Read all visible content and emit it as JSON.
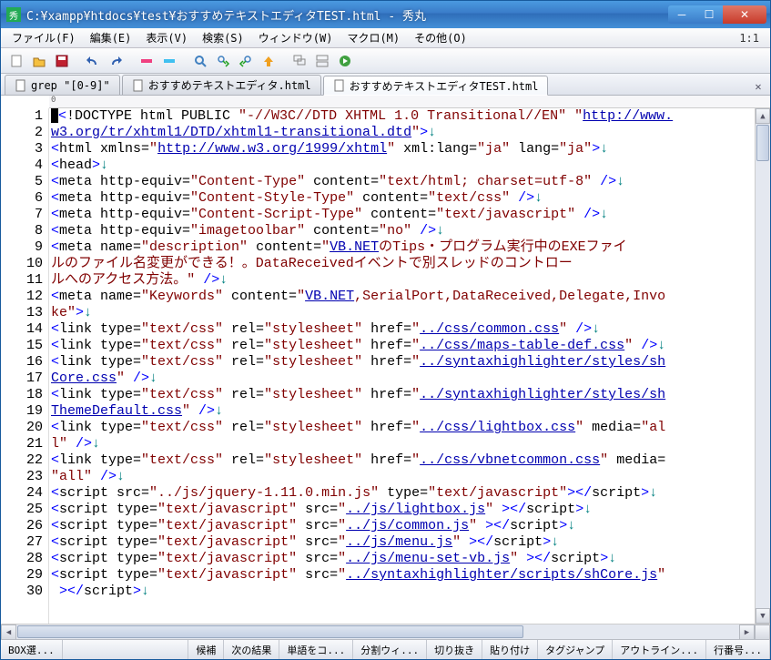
{
  "title": "C:¥xampp¥htdocs¥test¥おすすめテキストエディタTEST.html  - 秀丸",
  "cursor_pos": "1:1",
  "menus": {
    "file": "ファイル(F)",
    "edit": "編集(E)",
    "view": "表示(V)",
    "search": "検索(S)",
    "window": "ウィンドウ(W)",
    "macro": "マクロ(M)",
    "other": "その他(O)"
  },
  "tabs": [
    {
      "label": "grep \"[0-9]\"",
      "active": false
    },
    {
      "label": "おすすめテキストエディタ.html",
      "active": false
    },
    {
      "label": "おすすめテキストエディタTEST.html",
      "active": true
    }
  ],
  "ruler_start": "0",
  "lines": [
    1,
    2,
    3,
    4,
    5,
    6,
    7,
    8,
    9,
    10,
    11,
    12,
    13,
    14,
    15,
    16,
    17,
    18,
    19,
    20,
    21,
    22,
    23,
    24,
    25,
    26,
    27,
    28,
    29,
    30
  ],
  "status": {
    "box": "BOX選...",
    "cand": "候補",
    "nextres": "次の結果",
    "wordcopy": "単語をコ...",
    "split": "分割ウィ...",
    "cut": "切り抜き",
    "paste": "貼り付け",
    "tagjump": "タグジャンプ",
    "outline": "アウトライン...",
    "lineno": "行番号..."
  },
  "code": {
    "l1a": "<",
    "l1b": "!DOCTYPE html PUBLIC ",
    "l1c": "\"-//W3C//DTD XHTML 1.0 Transitional//EN\"",
    "l1d": " ",
    "l1e": "\"",
    "l1f": "http://www.",
    "l2a": "w3.org/tr/xhtml1/DTD/xhtml1-transitional.dtd",
    "l2b": "\"",
    "l2c": ">",
    "l2d": "↓",
    "l3a": "<",
    "l3b": "html xmlns=",
    "l3c": "\"",
    "l3d": "http://www.w3.org/1999/xhtml",
    "l3e": "\"",
    "l3f": " xml:lang=",
    "l3g": "\"ja\"",
    "l3h": " lang=",
    "l3i": "\"ja\"",
    "l3j": ">",
    "l3k": "↓",
    "l4a": "<",
    "l4b": "head",
    "l4c": ">",
    "l4d": "↓",
    "l5a": "<",
    "l5b": "meta http-equiv=",
    "l5c": "\"Content-Type\"",
    "l5d": " content=",
    "l5e": "\"text/html; charset=utf-8\"",
    "l5f": " />",
    "l5g": "↓",
    "l6a": "<",
    "l6b": "meta http-equiv=",
    "l6c": "\"Content-Style-Type\"",
    "l6d": " content=",
    "l6e": "\"text/css\"",
    "l6f": " />",
    "l6g": "↓",
    "l7a": "<",
    "l7b": "meta http-equiv=",
    "l7c": "\"Content-Script-Type\"",
    "l7d": " content=",
    "l7e": "\"text/javascript\"",
    "l7f": " />",
    "l7g": "↓",
    "l8a": "<",
    "l8b": "meta http-equiv=",
    "l8c": "\"imagetoolbar\"",
    "l8d": " content=",
    "l8e": "\"no\"",
    "l8f": " />",
    "l8g": "↓",
    "l9a": "<",
    "l9b": "meta name=",
    "l9c": "\"description\"",
    "l9d": " content=",
    "l9e": "\"",
    "l9f": "VB.NET",
    "l9g": "のTips・プログラム実行中のEXEファイ",
    "l10a": "ルのファイル名変更ができる！。DataReceivedイベントで別スレッドのコントロー",
    "l11a": "ルへのアクセス方法。",
    "l11b": "\"",
    "l11c": " />",
    "l11d": "↓",
    "l12a": "<",
    "l12b": "meta name=",
    "l12c": "\"Keywords\"",
    "l12d": " content=",
    "l12e": "\"",
    "l12f": "VB.NET",
    "l12g": ",SerialPort,DataReceived,Delegate,Invo",
    "l13a": "ke",
    "l13b": "\"",
    "l13c": ">",
    "l13d": "↓",
    "l14a": "<",
    "l14b": "link type=",
    "l14c": "\"text/css\"",
    "l14d": " rel=",
    "l14e": "\"stylesheet\"",
    "l14f": " href=",
    "l14g": "\"",
    "l14h": "../css/common.css",
    "l14i": "\"",
    "l14j": " />",
    "l14k": "↓",
    "l15a": "<",
    "l15b": "link type=",
    "l15c": "\"text/css\"",
    "l15d": " rel=",
    "l15e": "\"stylesheet\"",
    "l15f": " href=",
    "l15g": "\"",
    "l15h": "../css/maps-table-def.css",
    "l15i": "\"",
    "l15j": " />",
    "l15k": "↓",
    "l16a": "<",
    "l16b": "link type=",
    "l16c": "\"text/css\"",
    "l16d": " rel=",
    "l16e": "\"stylesheet\"",
    "l16f": " href=",
    "l16g": "\"",
    "l16h": "../syntaxhighlighter/styles/sh",
    "l17a": "Core.css",
    "l17b": "\"",
    "l17c": " />",
    "l17d": "↓",
    "l18a": "<",
    "l18b": "link type=",
    "l18c": "\"text/css\"",
    "l18d": " rel=",
    "l18e": "\"stylesheet\"",
    "l18f": " href=",
    "l18g": "\"",
    "l18h": "../syntaxhighlighter/styles/sh",
    "l19a": "ThemeDefault.css",
    "l19b": "\"",
    "l19c": " />",
    "l19d": "↓",
    "l20a": "<",
    "l20b": "link type=",
    "l20c": "\"text/css\"",
    "l20d": " rel=",
    "l20e": "\"stylesheet\"",
    "l20f": " href=",
    "l20g": "\"",
    "l20h": "../css/lightbox.css",
    "l20i": "\"",
    "l20j": " media=",
    "l20k": "\"al",
    "l21a": "l\"",
    "l21b": " />",
    "l21c": "↓",
    "l22a": "<",
    "l22b": "link type=",
    "l22c": "\"text/css\"",
    "l22d": " rel=",
    "l22e": "\"stylesheet\"",
    "l22f": " href=",
    "l22g": "\"",
    "l22h": "../css/vbnetcommon.css",
    "l22i": "\"",
    "l22j": " media=",
    "l23a": "\"all\"",
    "l23b": " />",
    "l23c": "↓",
    "l24a": "<",
    "l24b": "script src=",
    "l24c": "\"../js/jquery-1.11.0.min.js\"",
    "l24d": " type=",
    "l24e": "\"text/javascript\"",
    "l24f": "></",
    "l24g": "script",
    "l24h": ">",
    "l24i": "↓",
    "l25a": "<",
    "l25b": "script type=",
    "l25c": "\"text/javascript\"",
    "l25d": " src=",
    "l25e": "\"",
    "l25f": "../js/lightbox.js",
    "l25g": "\"",
    "l25h": " ></",
    "l25i": "script",
    "l25j": ">",
    "l25k": "↓",
    "l26a": "<",
    "l26b": "script type=",
    "l26c": "\"text/javascript\"",
    "l26d": " src=",
    "l26e": "\"",
    "l26f": "../js/common.js",
    "l26g": "\"",
    "l26h": " ></",
    "l26i": "script",
    "l26j": ">",
    "l26k": "↓",
    "l27a": "<",
    "l27b": "script type=",
    "l27c": "\"text/javascript\"",
    "l27d": " src=",
    "l27e": "\"",
    "l27f": "../js/menu.js",
    "l27g": "\"",
    "l27h": " ></",
    "l27i": "script",
    "l27j": ">",
    "l27k": "↓",
    "l28a": "<",
    "l28b": "script type=",
    "l28c": "\"text/javascript\"",
    "l28d": " src=",
    "l28e": "\"",
    "l28f": "../js/menu-set-vb.js",
    "l28g": "\"",
    "l28h": " ></",
    "l28i": "script",
    "l28j": ">",
    "l28k": "↓",
    "l29a": "<",
    "l29b": "script type=",
    "l29c": "\"text/javascript\"",
    "l29d": " src=",
    "l29e": "\"",
    "l29f": "../syntaxhighlighter/scripts/shCore.js",
    "l29g": "\"",
    "l30a": " ></",
    "l30b": "script",
    "l30c": ">",
    "l30d": "↓"
  }
}
